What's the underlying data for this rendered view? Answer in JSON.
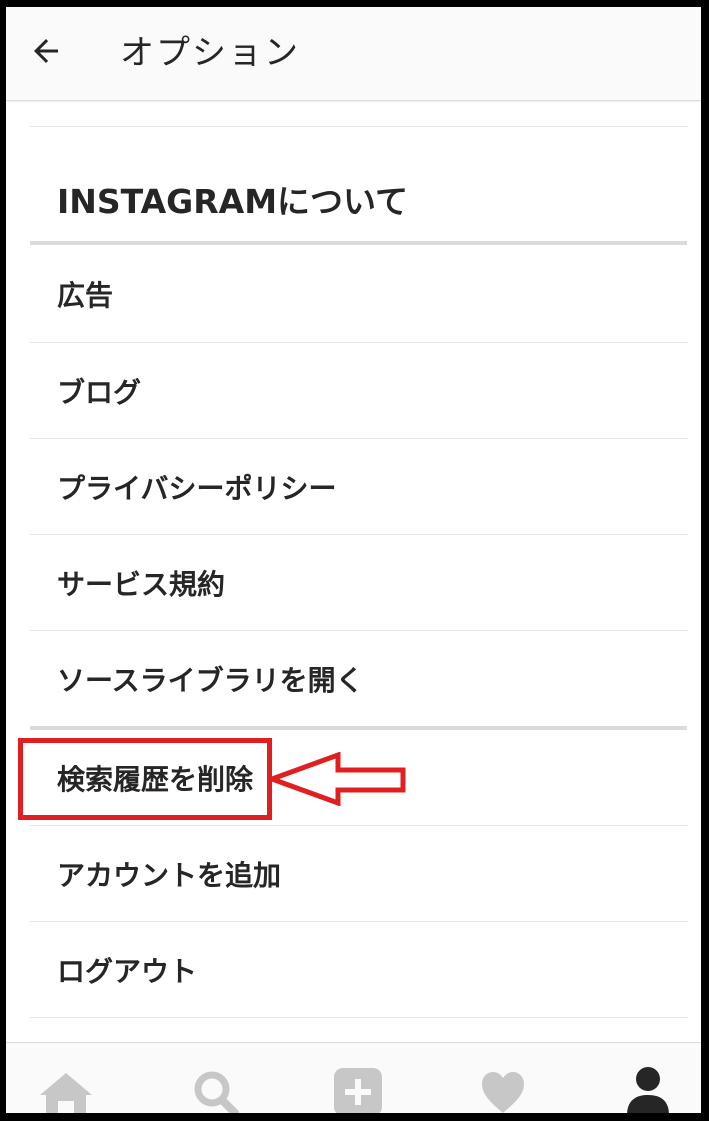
{
  "header": {
    "title": "オプション"
  },
  "section": {
    "title": "INSTAGRAMについて"
  },
  "about_items": [
    "広告",
    "ブログ",
    "プライバシーポリシー",
    "サービス規約",
    "ソースライブラリを開く"
  ],
  "account_items": [
    "検索履歴を削除",
    "アカウントを追加",
    "ログアウト"
  ],
  "colors": {
    "annotation_red": "#e02020",
    "text": "#262626",
    "nav_icon_gray": "#c7c7c7",
    "nav_icon_active": "#262626"
  },
  "bottom_nav": {
    "icons": [
      "home-icon",
      "search-icon",
      "add-icon",
      "heart-icon",
      "profile-icon"
    ],
    "active": "profile-icon"
  }
}
